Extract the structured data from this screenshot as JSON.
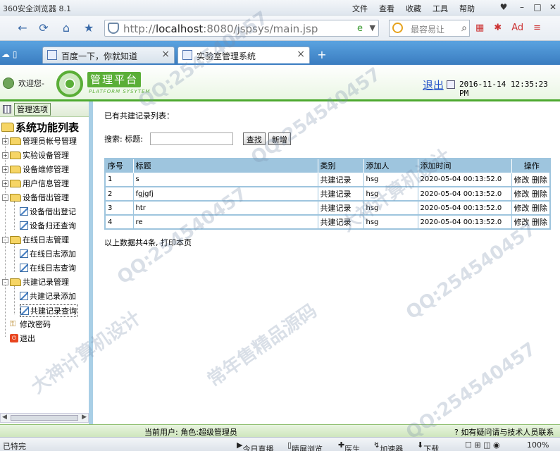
{
  "browser": {
    "app_title": "360安全浏览器 8.1",
    "menus": [
      "文件",
      "查看",
      "收藏",
      "工具",
      "帮助"
    ],
    "url_prefix": "http://",
    "url_host": "localhost",
    "url_path": ":8080/jspsys/main.jsp",
    "search_placeholder": "最容易让",
    "tabs": [
      {
        "label": "百度一下，你就知道",
        "active": false
      },
      {
        "label": "实验室管理系统",
        "active": true
      }
    ]
  },
  "header": {
    "welcome": "欢迎您-",
    "logo_text": "管理平台",
    "logo_sub": "PLATFORM SYSYTEM",
    "logout": "退出",
    "datetime": "2016-11-14 12:35:23 PM"
  },
  "sidebar": {
    "tab_button": "管理选项",
    "root": "系统功能列表",
    "items": [
      {
        "label": "管理员帐号管理",
        "type": "folder",
        "expander": "+"
      },
      {
        "label": "实验设备管理",
        "type": "folder",
        "expander": "+"
      },
      {
        "label": "设备维修管理",
        "type": "folder",
        "expander": "+"
      },
      {
        "label": "用户信息管理",
        "type": "folder",
        "expander": "+"
      },
      {
        "label": "设备借出管理",
        "type": "folder",
        "expander": "-"
      },
      {
        "label": "设备借出登记",
        "type": "leaf"
      },
      {
        "label": "设备归还查询",
        "type": "leaf"
      },
      {
        "label": "在线日志管理",
        "type": "folder",
        "expander": "-"
      },
      {
        "label": "在线日志添加",
        "type": "leaf"
      },
      {
        "label": "在线日志查询",
        "type": "leaf"
      },
      {
        "label": "共建记录管理",
        "type": "folder",
        "expander": "-"
      },
      {
        "label": "共建记录添加",
        "type": "leaf"
      },
      {
        "label": "共建记录查询",
        "type": "leaf"
      },
      {
        "label": "修改密码",
        "type": "key"
      },
      {
        "label": "退出",
        "type": "exit"
      }
    ]
  },
  "main": {
    "list_title": "已有共建记录列表：",
    "search_label": "搜索: 标题:",
    "search_value": "",
    "search_button": "查找",
    "add_button": "新增",
    "columns": [
      "序号",
      "标题",
      "类别",
      "添加人",
      "添加时间",
      "操作"
    ],
    "rows": [
      {
        "no": "1",
        "title": "s",
        "category": "共建记录",
        "adder": "hsg",
        "time": "2020-05-04 00:13:52.0"
      },
      {
        "no": "2",
        "title": "fgjgfj",
        "category": "共建记录",
        "adder": "hsg",
        "time": "2020-05-04 00:13:52.0"
      },
      {
        "no": "3",
        "title": "htr",
        "category": "共建记录",
        "adder": "hsg",
        "time": "2020-05-04 00:13:52.0"
      },
      {
        "no": "4",
        "title": "re",
        "category": "共建记录",
        "adder": "hsg",
        "time": "2020-05-04 00:13:52.0"
      }
    ],
    "edit_label": "修改",
    "delete_label": "删除",
    "summary": "以上数据共4条,",
    "print_label": "打印本页"
  },
  "footer": {
    "current_user": "当前用户: ",
    "role": "角色:超级管理员",
    "help": "如有疑问请与技术人员联系"
  },
  "statusbar": {
    "left": "已特完",
    "items": [
      "今日直播",
      "睛屏浏览",
      "医生",
      "加速器",
      "下载"
    ],
    "zoom": "100%"
  },
  "watermarks": [
    "QQ:254540457",
    "大神计算机设计",
    "常年售精品源码"
  ]
}
